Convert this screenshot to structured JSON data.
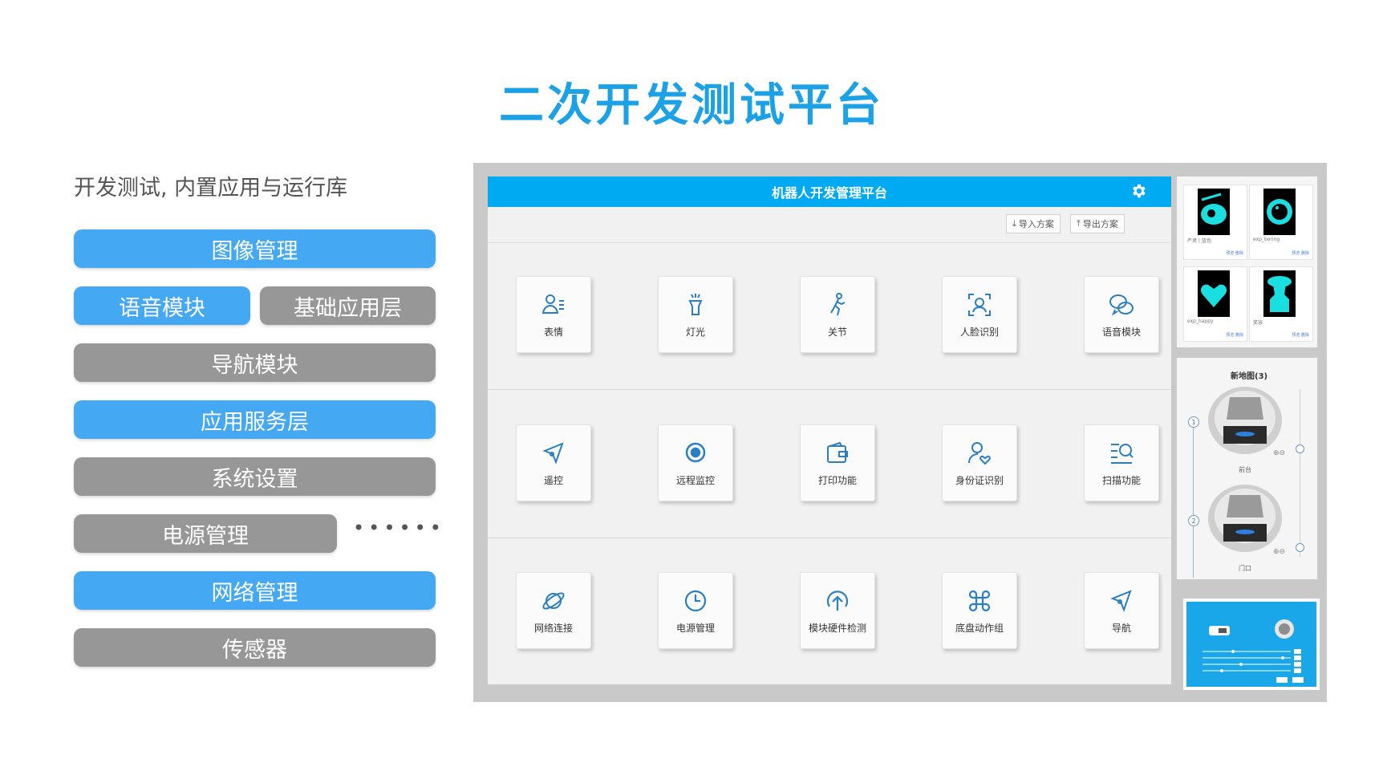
{
  "title": "二次开发测试平台",
  "subtitle": "开发测试, 内置应用与运行库",
  "modules": {
    "image_mgmt": "图像管理",
    "voice_module": "语音模块",
    "base_app_layer": "基础应用层",
    "nav_module": "导航模块",
    "app_service_layer": "应用服务层",
    "system_settings": "系统设置",
    "power_mgmt": "电源管理",
    "more": "••••••",
    "network_mgmt": "网络管理",
    "sensor": "传感器"
  },
  "colors": {
    "accent": "#1aa1e6",
    "blue_pill": "#45a8f2",
    "gray_pill": "#979797",
    "app_header": "#00aaf2"
  },
  "app": {
    "header_title": "机器人开发管理平台",
    "settings_icon": "gear-icon",
    "import_label": "导入方案",
    "export_label": "导出方案",
    "tiles": [
      {
        "label": "表情",
        "icon": "person-list-icon"
      },
      {
        "label": "灯光",
        "icon": "flashlight-icon"
      },
      {
        "label": "关节",
        "icon": "walking-person-icon"
      },
      {
        "label": "人脸识别",
        "icon": "face-scan-icon"
      },
      {
        "label": "语音模块",
        "icon": "chat-icon"
      },
      {
        "label": "遥控",
        "icon": "compass-icon"
      },
      {
        "label": "远程监控",
        "icon": "target-icon"
      },
      {
        "label": "打印功能",
        "icon": "wallet-icon"
      },
      {
        "label": "身份证识别",
        "icon": "person-heart-icon"
      },
      {
        "label": "扫描功能",
        "icon": "list-search-icon"
      },
      {
        "label": "网络连接",
        "icon": "planet-icon"
      },
      {
        "label": "电源管理",
        "icon": "clock-icon"
      },
      {
        "label": "模块硬件检测",
        "icon": "upload-circle-icon"
      },
      {
        "label": "底盘动作组",
        "icon": "command-icon"
      },
      {
        "label": "导航",
        "icon": "compass-icon"
      }
    ]
  },
  "expressions": [
    {
      "caption": "严肃 | 蓝色"
    },
    {
      "caption": "exp_boring"
    },
    {
      "caption": "exp_happy"
    },
    {
      "caption": "笑容"
    }
  ],
  "expression_links": "预览 删除",
  "map": {
    "title": "新地图(3)",
    "points": [
      {
        "num": "1",
        "caption": "前台"
      },
      {
        "num": "2",
        "caption": "门口"
      }
    ]
  }
}
